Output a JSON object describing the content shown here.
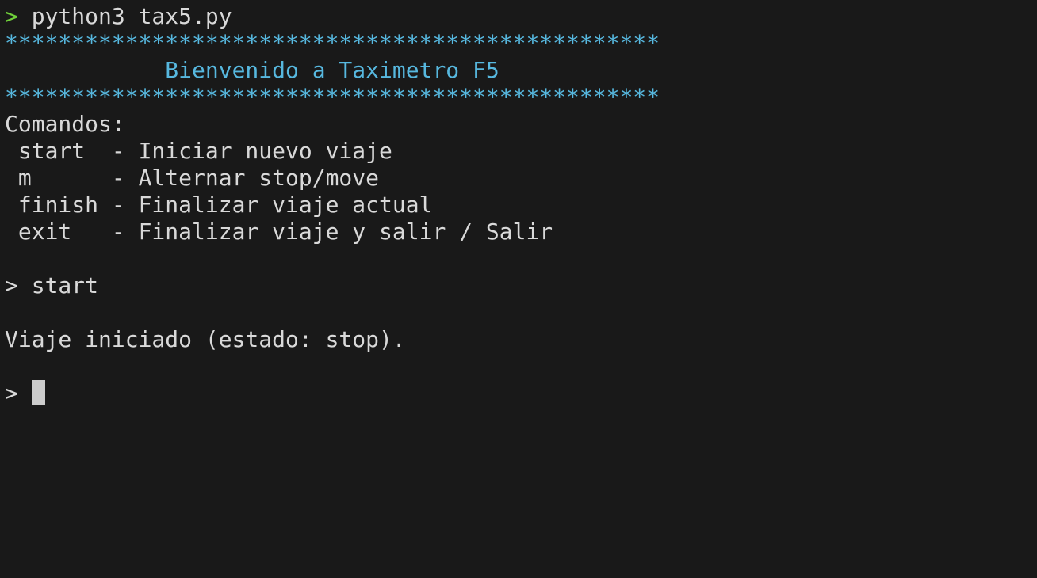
{
  "colors": {
    "background": "#191919",
    "text": "#d9d9d9",
    "prompt_green": "#6fcf3a",
    "accent_blue": "#57b8df",
    "cursor": "#cccccc"
  },
  "prompt_symbol": ">",
  "first_command": "python3 tax5.py",
  "banner": {
    "stars": "*************************************************",
    "title": "            Bienvenido a Taximetro F5"
  },
  "commands": {
    "heading": "Comandos:",
    "items": [
      " start  - Iniciar nuevo viaje",
      " m      - Alternar stop/move",
      " finish - Finalizar viaje actual",
      " exit   - Finalizar viaje y salir / Salir"
    ]
  },
  "second_command": "start",
  "status_message": "Viaje iniciado (estado: stop).",
  "current_input": ""
}
